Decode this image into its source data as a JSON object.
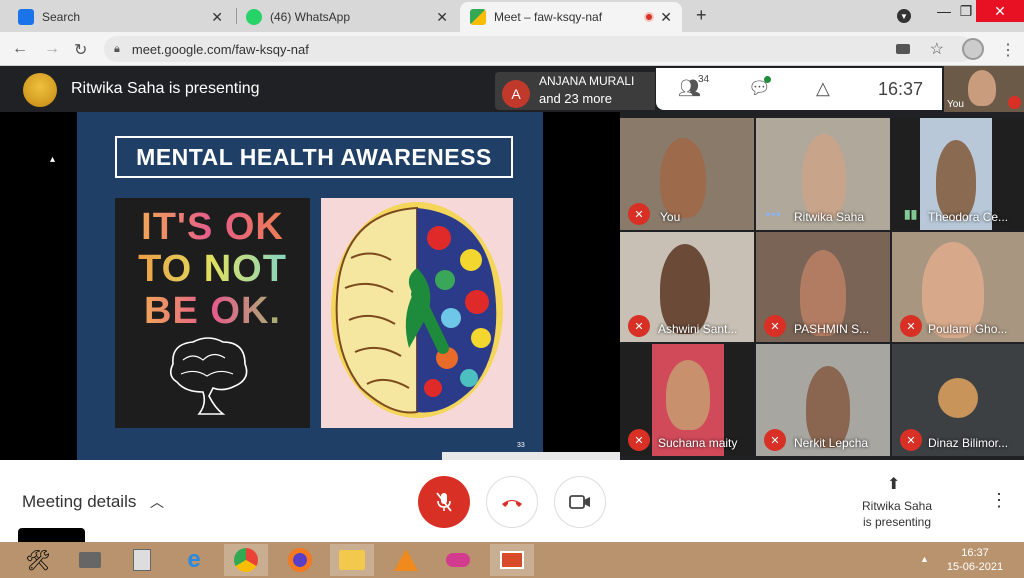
{
  "browser": {
    "tabs": [
      {
        "title": "Search",
        "favicon": "search-icon"
      },
      {
        "title": "(46) WhatsApp",
        "favicon": "whatsapp-icon"
      },
      {
        "title": "Meet – faw-ksqy-naf",
        "favicon": "meet-icon",
        "recording_dot": true
      }
    ],
    "new_tab": "+",
    "url": "meet.google.com/faw-ksqy-naf"
  },
  "meet": {
    "presenting_banner": "Ritwika Saha is presenting",
    "notification": {
      "avatar_letter": "A",
      "line1": "ANJANA MURALI",
      "line2": "and 23 more"
    },
    "participant_count": "34",
    "clock": "16:37",
    "self_thumb_label": "You"
  },
  "slide": {
    "title": "MENTAL HEALTH AWARENESS",
    "lines": [
      "IT'S OK",
      "TO NOT",
      "BE OK."
    ],
    "page_number": "33"
  },
  "participants": [
    {
      "name": "You",
      "status": "muted"
    },
    {
      "name": "Ritwika Saha",
      "status": "speaking"
    },
    {
      "name": "Theodora Ce...",
      "status": "speaking"
    },
    {
      "name": "Ashwini Sant...",
      "status": "muted"
    },
    {
      "name": "PASHMIN S...",
      "status": "muted"
    },
    {
      "name": "Poulami Gho...",
      "status": "muted"
    },
    {
      "name": "Suchana maity",
      "status": "muted"
    },
    {
      "name": "Nerkit Lepcha",
      "status": "muted"
    },
    {
      "name": "Dinaz Bilimor...",
      "status": "muted"
    }
  ],
  "controls": {
    "meeting_details": "Meeting details",
    "presenting_note": "Ritwika Saha is presenting"
  },
  "taskbar": {
    "time": "16:37",
    "date": "15-06-2021"
  },
  "colors": {
    "end_call_red": "#d93025",
    "meet_dark": "#202124",
    "taskbar": "#b8936d",
    "slide_bg": "#1f3f66"
  }
}
